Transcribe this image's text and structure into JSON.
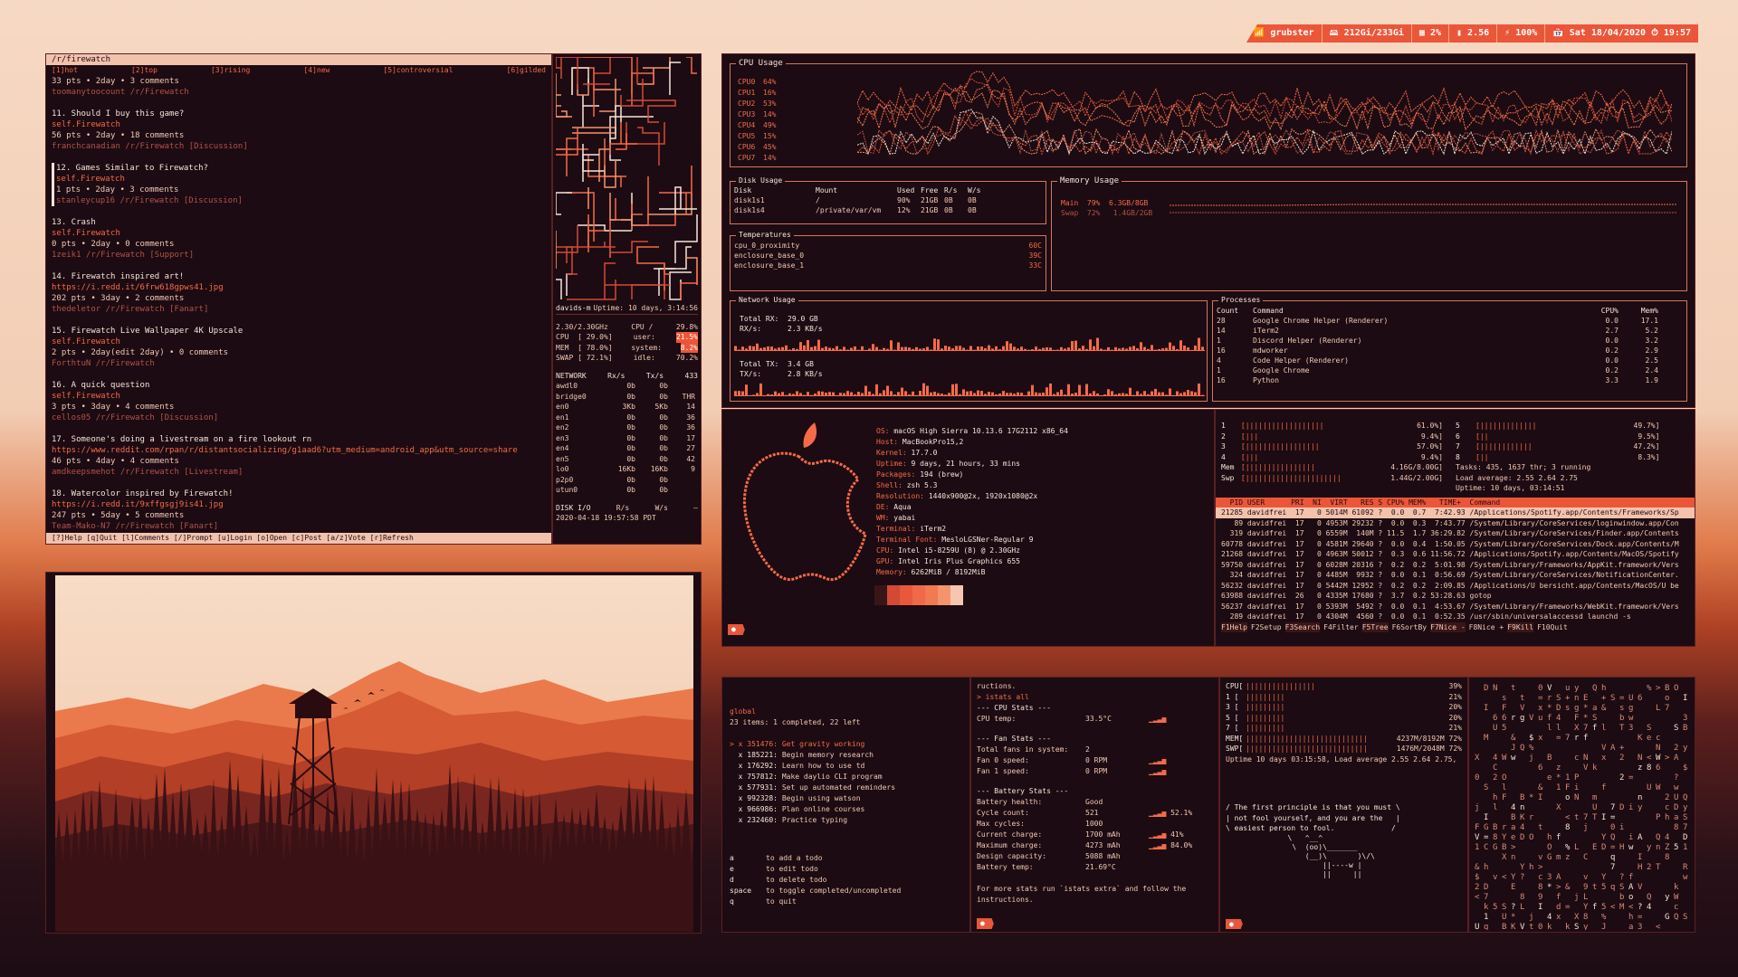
{
  "topbar": {
    "wifi": "grubster",
    "disk": "212Gi/233Gi",
    "cpu": "2%",
    "mem": "2.56",
    "battery": "100%",
    "datetime": "Sat 18/04/2020 ⏱ 19:57",
    "colors": {
      "accent": "#ec5638",
      "bg": "#1c0b12",
      "text": "#f1c9b5",
      "highlight": "#f56a48"
    }
  },
  "reddit": {
    "path": "/r/firewatch",
    "tabs": [
      "[1]hot",
      "[2]top",
      "[3]rising",
      "[4]new",
      "[5]controversial",
      "[6]gilded"
    ],
    "posts": [
      {
        "title": "",
        "author": "",
        "meta": "33 pts • 2day • 3 comments",
        "user": "toomanytoocount /r/Firewatch"
      },
      {
        "title": "11. Should I buy this game?",
        "author": "self.Firewatch",
        "meta": "56 pts • 2day • 18 comments",
        "user": "franchcanadian /r/Firewatch [Discussion]"
      },
      {
        "title": "12. Games Similar to Firewatch?",
        "author": "self.Firewatch",
        "meta": "1 pts • 2day • 3 comments",
        "user": "stanleycup16 /r/Firewatch [Discussion]"
      },
      {
        "title": "13. Crash",
        "author": "self.Firewatch",
        "meta": "0 pts • 2day • 0 comments",
        "user": "1zeik1 /r/Firewatch [Support]"
      },
      {
        "title": "14. Firewatch inspired art!",
        "author": "https://i.redd.it/6frw618gpws41.jpg",
        "meta": "202 pts • 3day • 2 comments",
        "user": "thedeletor /r/Firewatch [Fanart]"
      },
      {
        "title": "15. Firewatch Live Wallpaper 4K Upscale",
        "author": "self.Firewatch",
        "meta": "2 pts • 2day(edit 2day) • 0 comments",
        "user": "ForthtuN /r/Firewatch"
      },
      {
        "title": "16. A quick question",
        "author": "self.Firewatch",
        "meta": "3 pts • 3day • 4 comments",
        "user": "cellos05 /r/Firewatch [Discussion]"
      },
      {
        "title": "17. Someone's doing a livestream on a fire lookout rn",
        "author": "https://www.reddit.com/rpan/r/distantsocializing/g1aad6?utm_medium=android_app&utm_source=share",
        "meta": "46 pts • 4day • 4 comments",
        "user": "amdkeepsmehot /r/Firewatch [Livestream]"
      },
      {
        "title": "18. Watercolor inspired by Firewatch!",
        "author": "https://i.redd.it/9xffgsgj9is41.jpg",
        "meta": "247 pts • 5day • 5 comments",
        "user": "Team-Mako-N7 /r/Firewatch [Fanart]"
      }
    ],
    "footer": "[?]Help [q]Quit [l]Comments [/]Prompt [u]Login [o]Open [c]Post [a/z]Vote [r]Refresh"
  },
  "glances": {
    "header": "davids-m",
    "uptime": "Uptime: 10 days, 3:14:56",
    "cpu_lines": [
      [
        "2.30/2.30GHz",
        "CPU /",
        "29.8%"
      ],
      [
        "CPU  [ 29.0%]",
        "user:",
        "21.5%"
      ],
      [
        "MEM  [ 78.0%]",
        "system:",
        "8.2%"
      ],
      [
        "SWAP [ 72.1%]",
        "idle:",
        "70.2%"
      ]
    ],
    "net_header": [
      "NETWORK",
      "Rx/s",
      "Tx/s",
      "433"
    ],
    "net": [
      [
        "awdl0",
        "0b",
        "0b",
        ""
      ],
      [
        "bridge0",
        "0b",
        "0b",
        "THR"
      ],
      [
        "en0",
        "3Kb",
        "5Kb",
        "14"
      ],
      [
        "en1",
        "0b",
        "0b",
        "36"
      ],
      [
        "en2",
        "0b",
        "0b",
        "36"
      ],
      [
        "en3",
        "0b",
        "0b",
        "17"
      ],
      [
        "en4",
        "0b",
        "0b",
        "27"
      ],
      [
        "en5",
        "0b",
        "0b",
        "42"
      ],
      [
        "lo0",
        "16Kb",
        "16Kb",
        "9"
      ],
      [
        "p2p0",
        "0b",
        "0b",
        ""
      ],
      [
        "utun0",
        "0b",
        "0b",
        ""
      ]
    ],
    "disk_header": [
      "DISK I/O",
      "R/s",
      "W/s"
    ],
    "time": "2020-04-18 19:57:58 PDT"
  },
  "gtop": {
    "cpu_title": "CPU Usage",
    "cpus": [
      {
        "name": "CPU0",
        "val": "64%"
      },
      {
        "name": "CPU1",
        "val": "16%"
      },
      {
        "name": "CPU2",
        "val": "53%"
      },
      {
        "name": "CPU3",
        "val": "14%"
      },
      {
        "name": "CPU4",
        "val": "49%"
      },
      {
        "name": "CPU5",
        "val": "15%"
      },
      {
        "name": "CPU6",
        "val": "45%"
      },
      {
        "name": "CPU7",
        "val": "14%"
      }
    ],
    "disk_title": "Disk Usage",
    "disk_header": [
      "Disk",
      "Mount",
      "Used",
      "Free",
      "R/s",
      "W/s"
    ],
    "disks": [
      [
        "disk1s1",
        "/",
        "90%",
        "21GB",
        "0B",
        "0B"
      ],
      [
        "disk1s4",
        "/private/var/vm",
        "12%",
        "21GB",
        "0B",
        "0B"
      ]
    ],
    "mem_title": "Memory Usage",
    "mem_main": "Main  79%  6.3GB/8GB",
    "mem_swap": "Swap  72%   1.4GB/2GB",
    "temp_title": "Temperatures",
    "temps": [
      [
        "cpu_0_proximity",
        "60C"
      ],
      [
        "enclosure_base_0",
        "39C"
      ],
      [
        "enclosure_base_1",
        "33C"
      ]
    ],
    "net_title": "Network Usage",
    "net_rx": [
      "Total RX:",
      "29.0 GB",
      "RX/s:",
      "2.3 KB/s"
    ],
    "net_tx": [
      "Total TX:",
      "3.4 GB",
      "TX/s:",
      "2.8 KB/s"
    ],
    "proc_title": "Processes",
    "proc_header": [
      "Count",
      "Command",
      "CPU%",
      "Mem%"
    ],
    "procs": [
      [
        "28",
        "Google Chrome Helper (Renderer)",
        "0.0",
        "17.1"
      ],
      [
        "14",
        "iTerm2",
        "2.7",
        "5.2"
      ],
      [
        "1",
        "Discord Helper (Renderer)",
        "0.0",
        "3.2"
      ],
      [
        "16",
        "mdworker",
        "0.2",
        "2.9"
      ],
      [
        "4",
        "Code Helper (Renderer)",
        "0.0",
        "2.5"
      ],
      [
        "1",
        "Google Chrome",
        "0.2",
        "2.4"
      ],
      [
        "16",
        "Python",
        "3.3",
        "1.9"
      ]
    ]
  },
  "neofetch": {
    "info": [
      [
        "OS:",
        "macOS High Sierra 10.13.6 17G2112 x86_64"
      ],
      [
        "Host:",
        "MacBookPro15,2"
      ],
      [
        "Kernel:",
        "17.7.0"
      ],
      [
        "Uptime:",
        "9 days, 21 hours, 33 mins"
      ],
      [
        "Packages:",
        "194 (brew)"
      ],
      [
        "Shell:",
        "zsh 5.3"
      ],
      [
        "Resolution:",
        "1440x900@2x, 1920x1080@2x"
      ],
      [
        "DE:",
        "Aqua"
      ],
      [
        "WM:",
        "yabai"
      ],
      [
        "Terminal:",
        "iTerm2"
      ],
      [
        "Terminal Font:",
        "MesloLGSNer-Regular 9"
      ],
      [
        "CPU:",
        "Intel i5-8259U (8) @ 2.30GHz"
      ],
      [
        "GPU:",
        "Intel Iris Plus Graphics 655"
      ],
      [
        "Memory:",
        "6262MiB / 8192MiB"
      ]
    ],
    "palette": [
      "#3a1518",
      "#d24a36",
      "#e9573c",
      "#ee6a48",
      "#f07a52",
      "#f3946e",
      "#f6c6b0"
    ]
  },
  "htop": {
    "meters_left": [
      [
        "1",
        "61.0%"
      ],
      [
        "2",
        "9.4%"
      ],
      [
        "3",
        "57.0%"
      ],
      [
        "4",
        "9.4%"
      ],
      [
        "Mem",
        "4.16G/8.00G"
      ],
      [
        "Swp",
        "1.44G/2.00G"
      ]
    ],
    "meters_right": [
      [
        "5",
        "49.7%"
      ],
      [
        "6",
        "9.5%"
      ],
      [
        "7",
        "47.2%"
      ],
      [
        "8",
        "8.3%"
      ]
    ],
    "tasks": "Tasks: 435, 1637 thr; 3 running",
    "load": "Load average: 2.55 2.64 2.75",
    "uptime": "Uptime: 10 days, 03:14:51",
    "header": "  PID USER      PRI  NI  VIRT   RES S CPU% MEM%   TIME+  Command",
    "rows": [
      "21285 davidfrei  17   0 5014M 61092 ?  0.0  0.7  7:42.93 /Applications/Spotify.app/Contents/Frameworks/Sp",
      "   89 davidfrei  17   0 4953M 29232 ?  0.0  0.3  7:43.77 /System/Library/CoreServices/loginwindow.app/Con",
      "  319 davidfrei  17   0 6559M  140M ? 11.5  1.7 36:29.82 /System/Library/CoreServices/Finder.app/Contents",
      "60778 davidfrei  17   0 4581M 29640 ?  0.0  0.4  1:50.05 /System/Library/CoreServices/Dock.app/Contents/M",
      "21268 davidfrei  17   0 4963M 50012 ?  0.3  0.6 11:56.72 /Applications/Spotify.app/Contents/MacOS/Spotify",
      "59750 davidfrei  17   0 6028M 20316 ?  0.2  0.2  5:01.98 /System/Library/Frameworks/AppKit.framework/Vers",
      "  324 davidfrei  17   0 4485M  9932 ?  0.0  0.1  0:56.69 /System/Library/CoreServices/NotificationCenter.",
      "56232 davidfrei  17   0 5442M 12952 ?  0.2  0.2  2:09.85 /Applications/U bersicht.app/Contents/MacOS/U be",
      "63988 davidfrei  26   0 4335M 17680 ?  3.7  0.2 53:28.63 gotop",
      "56237 davidfrei  17   0 5393M  5492 ?  0.0  0.1  4:53.67 /System/Library/Frameworks/WebKit.framework/Vers",
      "  289 davidfrei  17   0 4304M  4560 ?  0.0  0.1  0:52.35 /usr/sbin/universalaccessd launchd -s"
    ],
    "footer": [
      "F1Help",
      "F2Setup",
      "F3Search",
      "F4Filter",
      "F5Tree",
      "F6SortBy",
      "F7Nice -",
      "F8Nice +",
      "F9Kill",
      "F10Quit"
    ]
  },
  "todo": {
    "title": "global",
    "summary": "23 items: 1 completed, 22 left",
    "items": [
      [
        "> x 351476:",
        "Get gravity working"
      ],
      [
        "  x 185221:",
        "Begin memory research"
      ],
      [
        "  x 176292:",
        "Learn how to use td"
      ],
      [
        "  x 757812:",
        "Make daylio CLI program"
      ],
      [
        "  x 577931:",
        "Set up automated reminders"
      ],
      [
        "  x 992328:",
        "Begin using watson"
      ],
      [
        "  x 966986:",
        "Plan online courses"
      ],
      [
        "  x 232460:",
        "Practice typing"
      ]
    ],
    "keys": [
      [
        "a",
        "to add a todo"
      ],
      [
        "e",
        "to edit todo"
      ],
      [
        "d",
        "to delete todo"
      ],
      [
        "space",
        "to toggle completed/uncompleted"
      ],
      [
        "q",
        "to quit"
      ]
    ]
  },
  "istats": {
    "top": "ructions.",
    "cmd": "> istats all",
    "cpu_head": "--- CPU Stats ---",
    "cpu_temp": [
      "CPU temp:",
      "33.5°C"
    ],
    "fan_head": "--- Fan Stats ---",
    "fans": [
      [
        "Total fans in system:",
        "2"
      ],
      [
        "Fan 0 speed:",
        "0 RPM"
      ],
      [
        "Fan 1 speed:",
        "0 RPM"
      ]
    ],
    "bat_head": "--- Battery Stats ---",
    "bat": [
      [
        "Battery health:",
        "Good",
        ""
      ],
      [
        "Cycle count:",
        "521",
        "52.1%"
      ],
      [
        "Max cycles:",
        "1000",
        ""
      ],
      [
        "Current charge:",
        "1700 mAh",
        "41%"
      ],
      [
        "Maximum charge:",
        "4273 mAh",
        "84.0%"
      ],
      [
        "Design capacity:",
        "5088 mAh",
        ""
      ],
      [
        "Battery temp:",
        "21.69°C",
        ""
      ]
    ],
    "extra": "For more stats run `istats extra` and follow the instructions."
  },
  "cowsay": {
    "htop_mini": [
      "CPU[",
      "1 [",
      "3 [",
      "5 [",
      "7 [",
      "MEM[",
      "SWP["
    ],
    "vals": [
      "39%",
      "21%",
      "20%",
      "20%",
      "21%",
      "4237M/8192M 72%",
      "1476M/2048M 72%"
    ],
    "uptime": "Uptime 10 days 03:15:58, Load average 2.55 2.64 2.75,",
    "quote": [
      "/ The first principle is that you must \\",
      "| not fool yourself, and you are the   |",
      "\\ easiest person to fool.             /"
    ]
  },
  "prompt": "●"
}
